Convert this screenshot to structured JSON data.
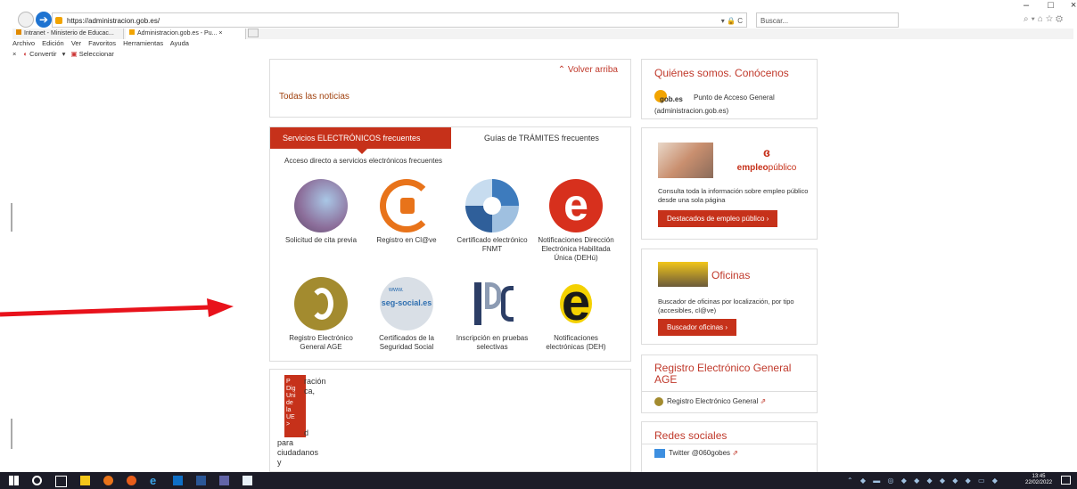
{
  "browser": {
    "url": "https://administracion.gob.es/",
    "search_placeholder": "Buscar...",
    "url_tools": "▾ 🔒 C",
    "tabs": [
      {
        "label": "Intranet - Ministerio de Educac..."
      },
      {
        "label": "Administracion.gob.es - Pu...  ×"
      }
    ],
    "menu": [
      "Archivo",
      "Edición",
      "Ver",
      "Favoritos",
      "Herramientas",
      "Ayuda"
    ],
    "toolbar": {
      "close": "×",
      "convert": "Convertir",
      "select": "Seleccionar"
    },
    "window_controls": {
      "minimize": "–",
      "maximize": "□",
      "close": "×"
    }
  },
  "main": {
    "back_to_top": "Volver arriba",
    "all_news": "Todas las noticias",
    "tabs": [
      {
        "label": "Servicios ELECTRÓNICOS frecuentes",
        "active": true
      },
      {
        "label": "Guías de TRÁMITES frecuentes",
        "active": false
      }
    ],
    "intro": "Acceso directo a servicios electrónicos frecuentes",
    "services": [
      {
        "label": "Solicitud de cita previa",
        "icon": "smartphone-hand-icon"
      },
      {
        "label": "Registro en Cl@ve",
        "icon": "clave-icon"
      },
      {
        "label": "Certificado electrónico FNMT",
        "icon": "fnmt-icon"
      },
      {
        "label": "Notificaciones Dirección Electrónica Habilitada Única (DEHú)",
        "icon": "dehu-icon"
      },
      {
        "label": "Registro Electrónico General AGE",
        "icon": "rec-age-icon"
      },
      {
        "label": "Certificados de la Seguridad Social",
        "icon": "seg-social-icon"
      },
      {
        "label": "Inscripción en pruebas selectivas",
        "icon": "ips-icon"
      },
      {
        "label": "Notificaciones electrónicas (DEH)",
        "icon": "deh-icon"
      }
    ],
    "seg_social_text": "seg-social.es",
    "seg_social_www": "www.",
    "promo": {
      "tab_text": "Plan de Digitalización UE",
      "tab_lines": [
        "P",
        "Dig",
        "Uni",
        "de",
        "la",
        "UE",
        ">"
      ],
      "side_text": [
        "ración",
        "ca,",
        "",
        "d",
        "para",
        "ciudadanos",
        "y"
      ]
    }
  },
  "sidebar": {
    "about": {
      "title": "Quiénes somos. Conócenos",
      "logo_text": "gob.es",
      "line1": "Punto de Acceso General",
      "line2": "(administracion.gob.es)"
    },
    "empleo": {
      "logo_text": "empleo",
      "logo_text2": "público",
      "description": "Consulta toda la información sobre empleo público desde una sola página",
      "button": "Destacados de empleo público"
    },
    "oficinas": {
      "title": "Oficinas",
      "description": "Buscador de oficinas por localización, por tipo (accesibles, cl@ve)",
      "button": "Buscador oficinas"
    },
    "registro": {
      "title": "Registro Electrónico General AGE",
      "link": "Registro Electrónico General"
    },
    "redes": {
      "title": "Redes sociales",
      "twitter": "Twitter @060gobes"
    }
  },
  "taskbar": {
    "time": "13:45",
    "date": "22/02/2022"
  },
  "colors": {
    "accent": "#c6311a",
    "orange_link": "#d94415",
    "arrow": "#e8121b",
    "title_red": "#c0392b"
  }
}
